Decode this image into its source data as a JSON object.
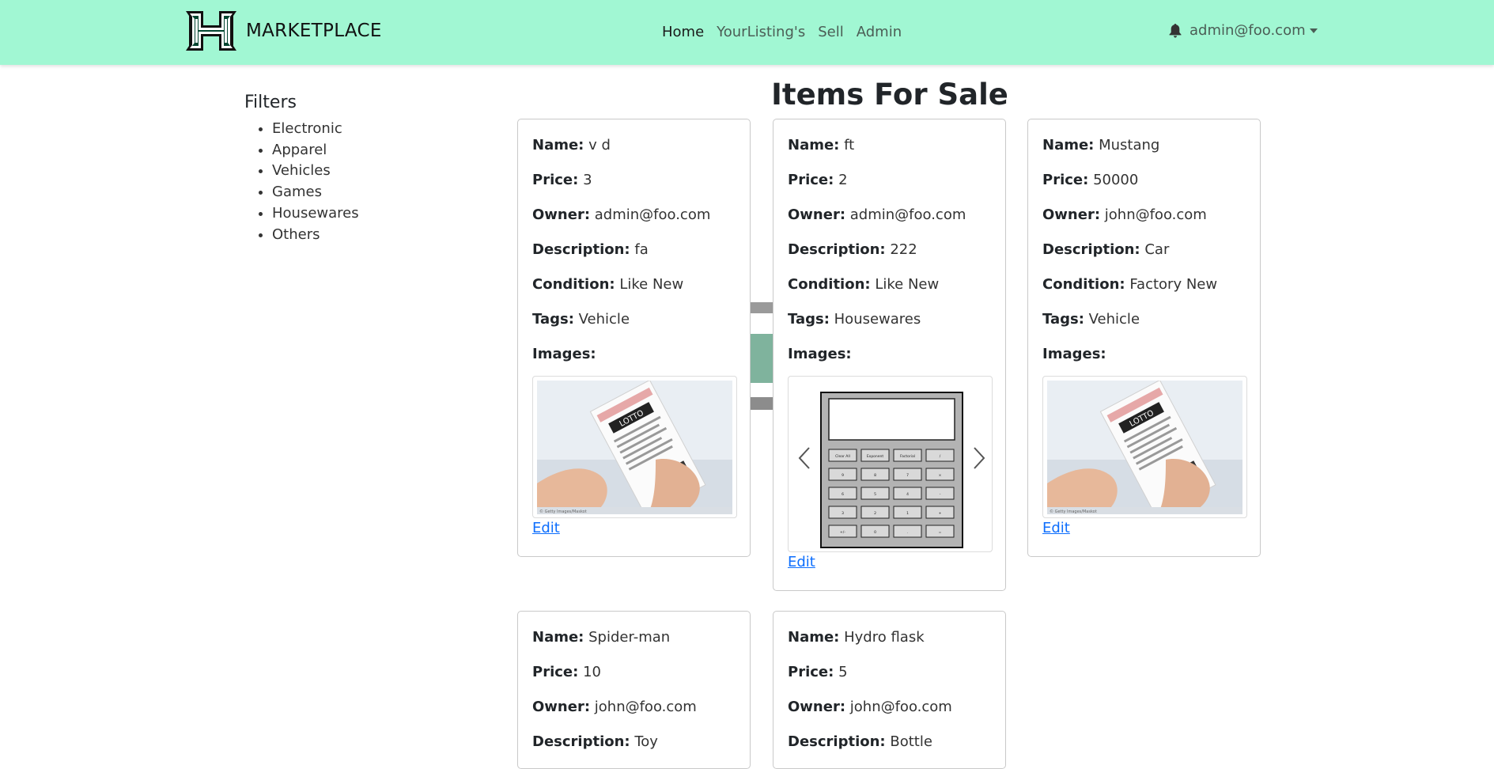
{
  "app": {
    "brand": "MARKETPLACE"
  },
  "nav": {
    "links": [
      {
        "label": "Home"
      },
      {
        "label": "YourListing's"
      },
      {
        "label": "Sell"
      },
      {
        "label": "Admin"
      }
    ],
    "user": "admin@foo.com",
    "bell_icon": "bell-icon"
  },
  "filters": {
    "title": "Filters",
    "items": [
      "Electronic",
      "Apparel",
      "Vehicles",
      "Games",
      "Housewares",
      "Others"
    ]
  },
  "page": {
    "title": "Items For Sale"
  },
  "labels": {
    "name": "Name:",
    "price": "Price:",
    "owner": "Owner:",
    "description": "Description:",
    "condition": "Condition:",
    "tags": "Tags:",
    "images": "Images:",
    "edit": "Edit"
  },
  "items": [
    {
      "name": "v d",
      "price": "3",
      "owner": "admin@foo.com",
      "description": "fa",
      "condition": "Like New",
      "tags": "Vehicle",
      "image": "lottery-ticket-photo"
    },
    {
      "name": "ft",
      "price": "2",
      "owner": "admin@foo.com",
      "description": "222",
      "condition": "Like New",
      "tags": "Housewares",
      "image": "calculator-image"
    },
    {
      "name": "Mustang",
      "price": "50000",
      "owner": "john@foo.com",
      "description": "Car",
      "condition": "Factory New",
      "tags": "Vehicle",
      "image": "lottery-ticket-photo"
    },
    {
      "name": "Spider-man",
      "price": "10",
      "owner": "john@foo.com",
      "description": "Toy"
    },
    {
      "name": "Hydro flask",
      "price": "5",
      "owner": "john@foo.com",
      "description": "Bottle"
    }
  ],
  "calculator": {
    "keys": [
      "Clear All",
      "Exponent",
      "Factorial",
      "/",
      "9",
      "8",
      "7",
      "×",
      "6",
      "5",
      "4",
      "-",
      "3",
      "2",
      "1",
      "+",
      "+/-",
      "0",
      ".",
      "="
    ]
  },
  "photo_caption": "© Getty Images/Maskot",
  "ticket_text": "LOTTO",
  "colors": {
    "navbar": "#a1f7d3",
    "link": "#0d6efd",
    "logo_green": "#024731"
  }
}
